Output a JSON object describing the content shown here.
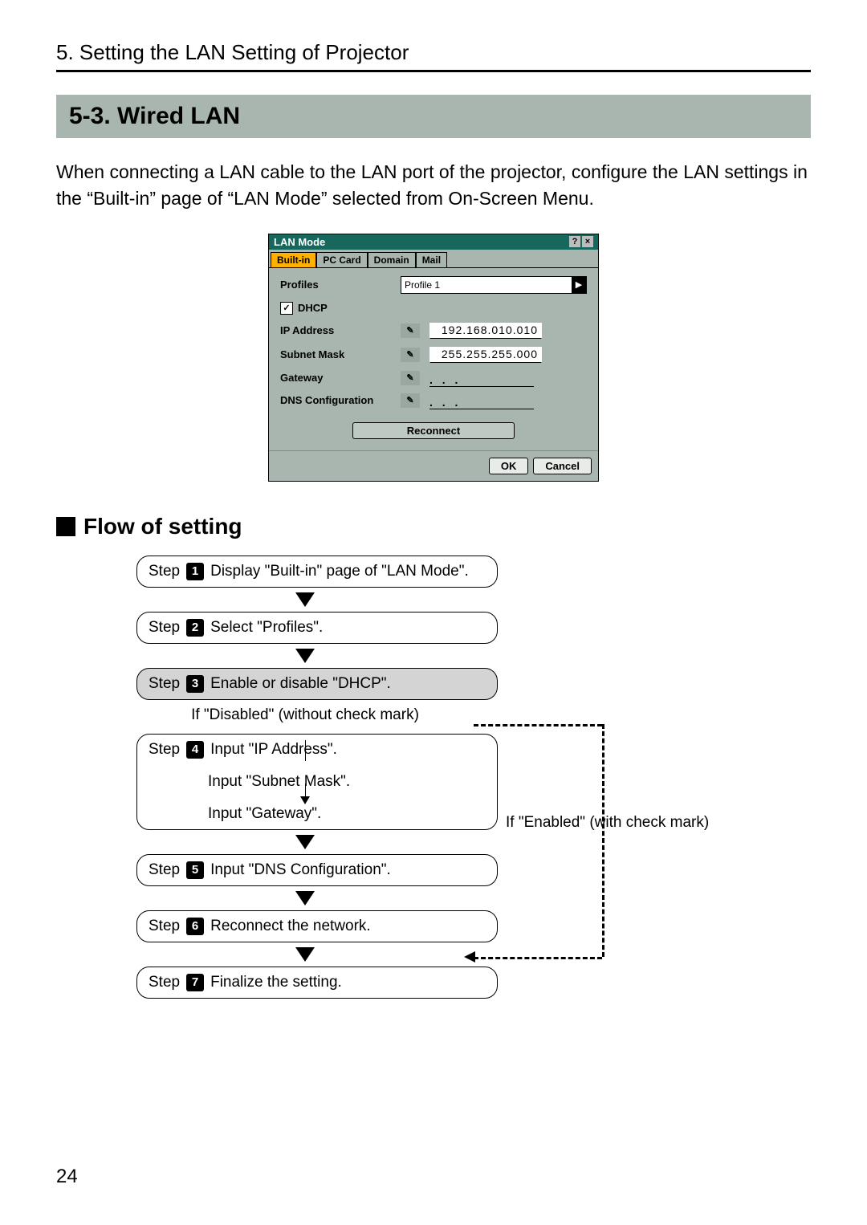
{
  "chapter_title": "5. Setting the LAN Setting of Projector",
  "section_title": "5-3.  Wired LAN",
  "intro_text": "When connecting a LAN cable to the LAN port of the projector, configure the LAN settings in the “Built-in” page of “LAN Mode” selected from On-Screen Menu.",
  "dialog": {
    "title": "LAN Mode",
    "tabs": [
      "Built-in",
      "PC Card",
      "Domain",
      "Mail"
    ],
    "active_tab_index": 0,
    "profiles_label": "Profiles",
    "profiles_value": "Profile 1",
    "dhcp_label": "DHCP",
    "dhcp_checked": true,
    "rows": [
      {
        "label": "IP Address",
        "value": "192.168.010.010"
      },
      {
        "label": "Subnet Mask",
        "value": "255.255.255.000"
      },
      {
        "label": "Gateway",
        "value": ""
      },
      {
        "label": "DNS Configuration",
        "value": ""
      }
    ],
    "reconnect": "Reconnect",
    "ok": "OK",
    "cancel": "Cancel"
  },
  "flow_heading": "Flow of setting",
  "steps": {
    "s1": "Display \"Built-in\" page of \"LAN Mode\".",
    "s2": "Select \"Profiles\".",
    "s3": "Enable or disable \"DHCP\".",
    "note_disabled": "If \"Disabled\" (without check mark)",
    "note_enabled": "If \"Enabled\" (with check mark)",
    "s4a": "Input \"IP Address\".",
    "s4b": "Input \"Subnet Mask\".",
    "s4c": "Input \"Gateway\".",
    "s5": "Input \"DNS Configuration\".",
    "s6": "Reconnect the network.",
    "s7": "Finalize the setting.",
    "step_word": "Step"
  },
  "page_number": "24"
}
